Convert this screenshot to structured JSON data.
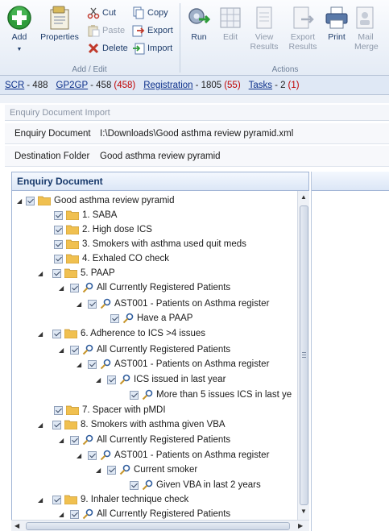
{
  "ribbon": {
    "add_edit": {
      "group_label": "Add / Edit",
      "add_label": "Add",
      "properties_label": "Properties",
      "cut_label": "Cut",
      "paste_label": "Paste",
      "delete_label": "Delete",
      "copy_label": "Copy",
      "export_label": "Export",
      "import_label": "Import"
    },
    "actions": {
      "group_label": "Actions",
      "run_label": "Run",
      "edit_label": "Edit",
      "view_results_label": "View Results",
      "export_results_label": "Export Results",
      "print_label": "Print",
      "mail_merge_label": "Mail Merge"
    }
  },
  "statusbar": {
    "items": [
      {
        "name": "SCR",
        "count": "- 488",
        "extra": ""
      },
      {
        "name": "GP2GP",
        "count": "- 458",
        "extra": "(458)"
      },
      {
        "name": "Registration",
        "count": "- 1805",
        "extra": "(55)"
      },
      {
        "name": "Tasks",
        "count": "- 2",
        "extra": "(1)"
      }
    ]
  },
  "dialog": {
    "title": "Enquiry Document Import",
    "enquiry_document_label": "Enquiry Document",
    "enquiry_document_value": "I:\\Downloads\\Good asthma review pyramid.xml",
    "destination_folder_label": "Destination Folder",
    "destination_folder_value": "Good asthma review pyramid",
    "panel_header": "Enquiry Document"
  },
  "tree": [
    {
      "label": "Good asthma review pyramid",
      "icon": "folder-icon",
      "expanded": true
    },
    {
      "label": "1. SABA",
      "icon": "folder-icon",
      "expanded": false
    },
    {
      "label": "2. High dose ICS",
      "icon": "folder-icon",
      "expanded": false
    },
    {
      "label": "3. Smokers with asthma used quit meds",
      "icon": "folder-icon",
      "expanded": false
    },
    {
      "label": "4. Exhaled CO check",
      "icon": "folder-icon",
      "expanded": false
    },
    {
      "label": "5. PAAP",
      "icon": "folder-icon",
      "expanded": true
    },
    {
      "label": "All Currently Registered Patients",
      "icon": "search-key-icon",
      "expanded": true
    },
    {
      "label": "AST001 - Patients on Asthma register",
      "icon": "search-key-icon",
      "expanded": true
    },
    {
      "label": "Have a PAAP",
      "icon": "search-key-icon",
      "expanded": false
    },
    {
      "label": "6. Adherence to ICS >4 issues",
      "icon": "folder-icon",
      "expanded": true
    },
    {
      "label": "All Currently Registered Patients",
      "icon": "search-key-icon",
      "expanded": true
    },
    {
      "label": "AST001 - Patients on Asthma register",
      "icon": "search-key-icon",
      "expanded": true
    },
    {
      "label": "ICS issued in last year",
      "icon": "search-key-icon",
      "expanded": true
    },
    {
      "label": "More than 5 issues ICS in last ye",
      "icon": "search-key-icon",
      "expanded": false
    },
    {
      "label": "7. Spacer with pMDI",
      "icon": "folder-icon",
      "expanded": false
    },
    {
      "label": "8. Smokers with asthma given VBA",
      "icon": "folder-icon",
      "expanded": true
    },
    {
      "label": "All Currently Registered Patients",
      "icon": "search-key-icon",
      "expanded": true
    },
    {
      "label": "AST001 - Patients on Asthma register",
      "icon": "search-key-icon",
      "expanded": true
    },
    {
      "label": "Current smoker",
      "icon": "search-key-icon",
      "expanded": true
    },
    {
      "label": "Given VBA in last 2 years",
      "icon": "search-key-icon",
      "expanded": false
    },
    {
      "label": "9. Inhaler technique check",
      "icon": "folder-icon",
      "expanded": true
    },
    {
      "label": "All Currently Registered Patients",
      "icon": "search-key-icon",
      "expanded": true
    }
  ]
}
